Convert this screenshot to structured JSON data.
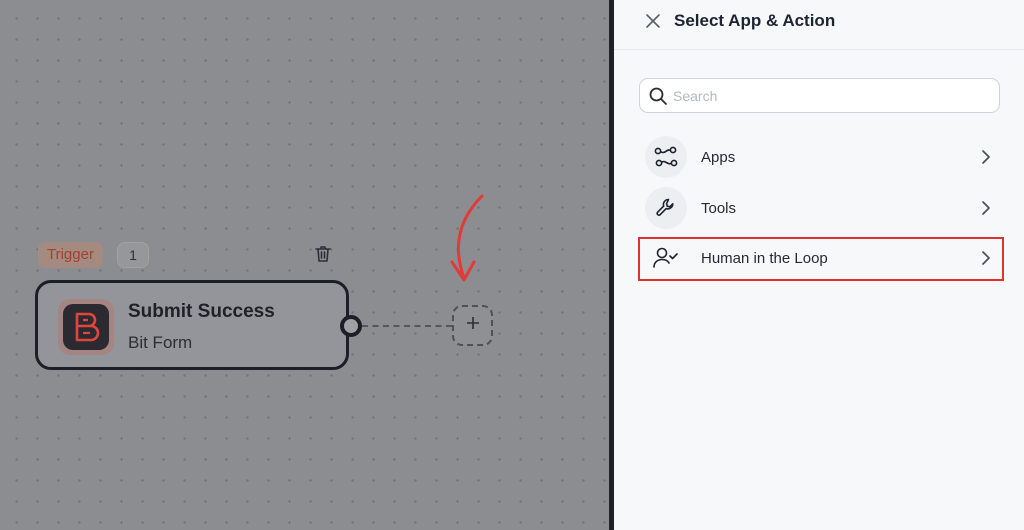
{
  "canvas": {
    "trigger_label": "Trigger",
    "trigger_count": "1",
    "node": {
      "title": "Submit Success",
      "subtitle": "Bit Form",
      "logo_icon": "bit-form-logo-icon"
    },
    "add_button_icon": "plus-icon",
    "annotation_icon": "red-arrow-icon"
  },
  "panel": {
    "title": "Select App & Action",
    "search": {
      "placeholder": "Search",
      "value": ""
    },
    "items": [
      {
        "label": "Apps",
        "icon": "apps-connect-icon"
      },
      {
        "label": "Tools",
        "icon": "wrench-icon"
      },
      {
        "label": "Human in the Loop",
        "icon": "user-check-icon"
      }
    ]
  },
  "colors": {
    "highlight": "#e0312f",
    "trigger_text": "#a5402f",
    "node_border": "#1c1e28"
  }
}
